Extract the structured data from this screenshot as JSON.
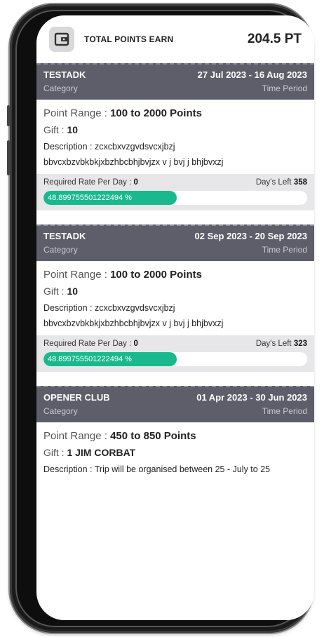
{
  "header": {
    "title": "TOTAL POINTS EARN",
    "points": "204.5 PT"
  },
  "labels": {
    "category": "Category",
    "time_period": "Time Period",
    "point_range": "Point Range :",
    "gift": "Gift :",
    "description": "Description :",
    "required_rate": "Required Rate Per Day :",
    "days_left": "Day's Left"
  },
  "cards": [
    {
      "name": "TESTADK",
      "dates": "27 Jul 2023 - 16 Aug 2023",
      "point_range": "100 to 2000 Points",
      "gift": "10",
      "description_line1": "zcxcbxvzgvdsvcxjbzj",
      "description_line2": "bbvcxbzvbkbkjxbzhbcbhjbvjzx v j bvj j bhjbvxzj",
      "rate": "0",
      "days_left": "358",
      "progress_label": "48.899755501222494 %",
      "progress_fraction": 0.489
    },
    {
      "name": "TESTADK",
      "dates": "02 Sep 2023 - 20 Sep 2023",
      "point_range": "100 to 2000 Points",
      "gift": "10",
      "description_line1": "zcxcbxvzgvdsvcxjbzj",
      "description_line2": "bbvcxbzvbkbkjxbzhbcbhjbvjzx v j bvj j bhjbvxzj",
      "rate": "0",
      "days_left": "323",
      "progress_label": "48.899755501222494 %",
      "progress_fraction": 0.489
    },
    {
      "name": "OPENER CLUB",
      "dates": "01 Apr 2023 - 30 Jun 2023",
      "point_range": "450 to 850 Points",
      "gift": "1 JIM CORBAT",
      "description_line1": "Trip will be organised between 25 - July to 25"
    }
  ],
  "colors": {
    "header_bar": "#5d5e6a",
    "progress": "#19b98d",
    "rate_box": "#e7e7e9"
  }
}
